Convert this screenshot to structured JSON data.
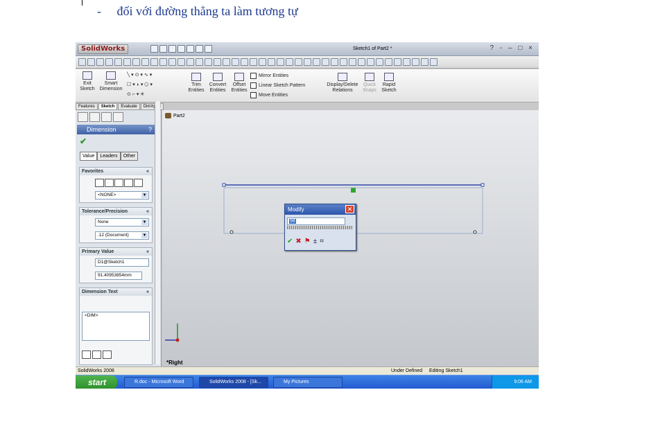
{
  "doc": {
    "bullet": "-",
    "text": "đối với đường thẳng ta làm tương tự"
  },
  "window": {
    "app_logo": "SolidWorks",
    "title": "Sketch1 of Part2 *",
    "controls": "? - – □ ×"
  },
  "ribbon": {
    "exit_sketch": "Exit Sketch",
    "smart_dimension": "Smart Dimension",
    "trim": "Trim Entities",
    "convert": "Convert Entities",
    "offset": "Offset Entities",
    "mirror": "Mirror Entities",
    "linear_pattern": "Linear Sketch Pattern",
    "move": "Move Entities",
    "display_delete": "Display/Delete Relations",
    "quick_snaps": "Quick Snaps",
    "rapid_sketch": "Rapid Sketch"
  },
  "command_tabs": [
    "Features",
    "Sketch",
    "Evaluate",
    "DimXpert"
  ],
  "property_manager": {
    "title": "Dimension",
    "help": "?",
    "tabs": [
      "Value",
      "Leaders",
      "Other"
    ],
    "favorites": {
      "label": "Favorites",
      "selected": "<NONE>"
    },
    "tolerance": {
      "label": "Tolerance/Precision",
      "type": "None",
      "precision": ".12 (Document)"
    },
    "primary": {
      "label": "Primary Value",
      "name": "D1@Sketch1",
      "value": "91.40953854mm"
    },
    "dimtext": {
      "label": "Dimension Text",
      "content": "<DIM>"
    }
  },
  "tree": {
    "root": "Part2"
  },
  "view_label": "*Right",
  "modify": {
    "title": "Modify",
    "value": "98"
  },
  "status": {
    "app": "SolidWorks 2008",
    "state": "Under Defined",
    "mode": "Editing Sketch1"
  },
  "taskbar": {
    "start": "start",
    "tasks": [
      "R.doc - Microsoft Word",
      "SolidWorks 2008 - [Sk...",
      "My Pictures"
    ],
    "clock": "9:06 AM"
  }
}
